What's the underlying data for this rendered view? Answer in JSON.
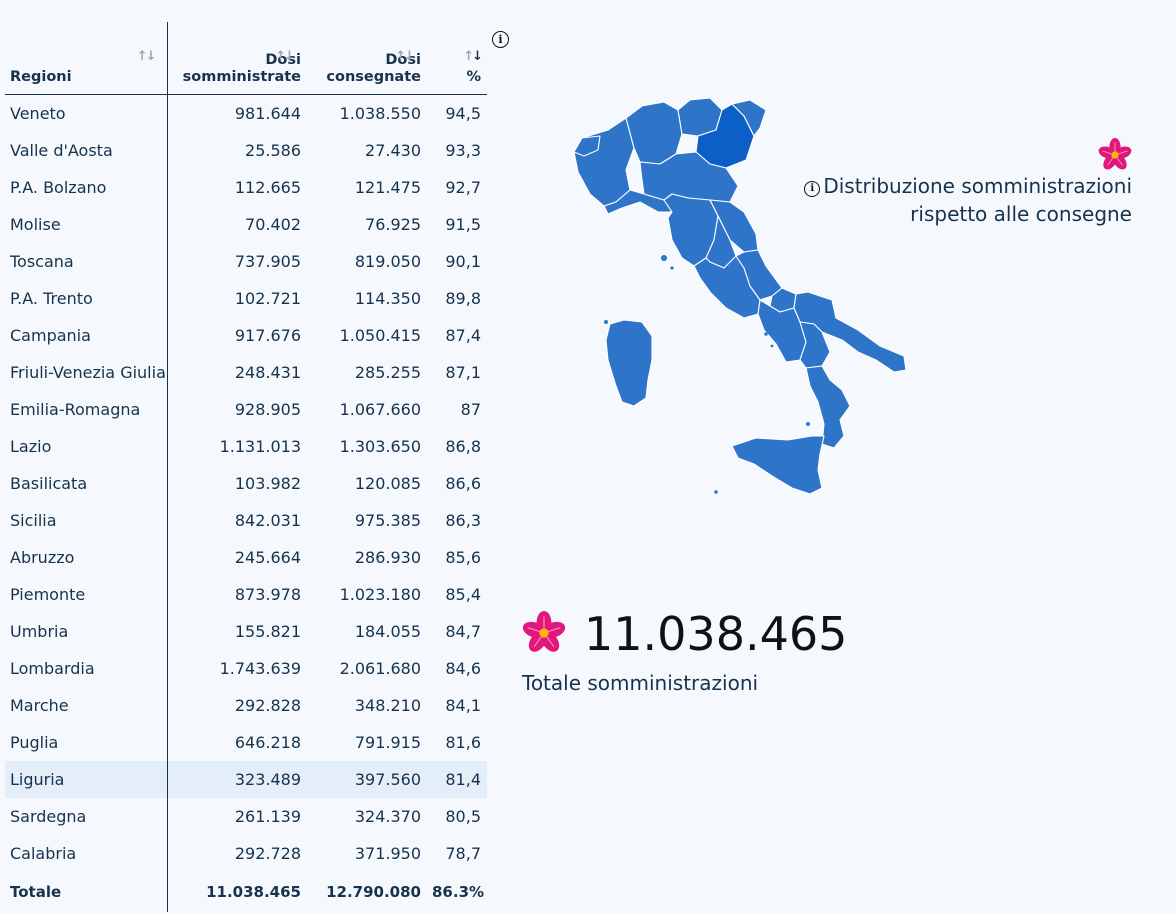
{
  "table": {
    "headers": {
      "region": "Regioni",
      "som_line1": "Dosi",
      "som_line2": "somministrate",
      "con_line1": "Dosi",
      "con_line2": "consegnate",
      "pct": "%"
    },
    "rows": [
      {
        "region": "Veneto",
        "som": "981.644",
        "con": "1.038.550",
        "pct": "94,5"
      },
      {
        "region": "Valle d'Aosta",
        "som": "25.586",
        "con": "27.430",
        "pct": "93,3"
      },
      {
        "region": "P.A. Bolzano",
        "som": "112.665",
        "con": "121.475",
        "pct": "92,7"
      },
      {
        "region": "Molise",
        "som": "70.402",
        "con": "76.925",
        "pct": "91,5"
      },
      {
        "region": "Toscana",
        "som": "737.905",
        "con": "819.050",
        "pct": "90,1"
      },
      {
        "region": "P.A. Trento",
        "som": "102.721",
        "con": "114.350",
        "pct": "89,8"
      },
      {
        "region": "Campania",
        "som": "917.676",
        "con": "1.050.415",
        "pct": "87,4"
      },
      {
        "region": "Friuli-Venezia Giulia",
        "som": "248.431",
        "con": "285.255",
        "pct": "87,1"
      },
      {
        "region": "Emilia-Romagna",
        "som": "928.905",
        "con": "1.067.660",
        "pct": "87"
      },
      {
        "region": "Lazio",
        "som": "1.131.013",
        "con": "1.303.650",
        "pct": "86,8"
      },
      {
        "region": "Basilicata",
        "som": "103.982",
        "con": "120.085",
        "pct": "86,6"
      },
      {
        "region": "Sicilia",
        "som": "842.031",
        "con": "975.385",
        "pct": "86,3"
      },
      {
        "region": "Abruzzo",
        "som": "245.664",
        "con": "286.930",
        "pct": "85,6"
      },
      {
        "region": "Piemonte",
        "som": "873.978",
        "con": "1.023.180",
        "pct": "85,4"
      },
      {
        "region": "Umbria",
        "som": "155.821",
        "con": "184.055",
        "pct": "84,7"
      },
      {
        "region": "Lombardia",
        "som": "1.743.639",
        "con": "2.061.680",
        "pct": "84,6"
      },
      {
        "region": "Marche",
        "som": "292.828",
        "con": "348.210",
        "pct": "84,1"
      },
      {
        "region": "Puglia",
        "som": "646.218",
        "con": "791.915",
        "pct": "81,6"
      },
      {
        "region": "Liguria",
        "som": "323.489",
        "con": "397.560",
        "pct": "81,4",
        "highlighted": true
      },
      {
        "region": "Sardegna",
        "som": "261.139",
        "con": "324.370",
        "pct": "80,5"
      },
      {
        "region": "Calabria",
        "som": "292.728",
        "con": "371.950",
        "pct": "78,7"
      }
    ],
    "total": {
      "label": "Totale",
      "som": "11.038.465",
      "con": "12.790.080",
      "pct": "86.3%"
    }
  },
  "icons": {
    "info": "info-icon",
    "sort": "sort-icon",
    "flower": "primula-flower-icon",
    "map": "italy-regions-map"
  },
  "map": {
    "legend_line1": "Distribuzione somministrazioni",
    "legend_line2": "rispetto alle consegne",
    "fill_color": "#2e74c9",
    "dark_fill_color": "#0b5fc7",
    "border_color": "#ffffff"
  },
  "summary": {
    "total_value": "11.038.465",
    "total_label": "Totale somministrazioni"
  },
  "colors": {
    "text": "#17324d",
    "background": "#f5f9fd",
    "highlight_row": "#e4eef8",
    "flower_petals": "#e2177b",
    "flower_center": "#ffb400"
  }
}
